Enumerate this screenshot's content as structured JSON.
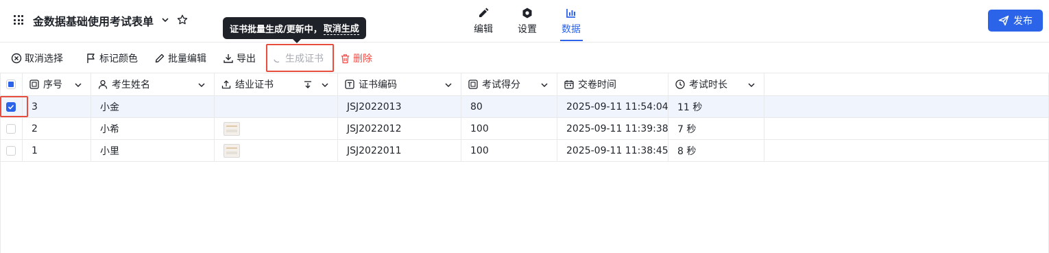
{
  "header": {
    "title": "金数据基础使用考试表单",
    "tabs": [
      {
        "label": "编辑",
        "icon": "pencil-icon"
      },
      {
        "label": "设置",
        "icon": "hexagon-settings-icon"
      },
      {
        "label": "数据",
        "icon": "bar-chart-icon",
        "active": true
      }
    ],
    "publish_label": "发布"
  },
  "tooltip": {
    "text": "证书批量生成/更新中，",
    "action": "取消生成"
  },
  "toolbar": {
    "cancel_select": "取消选择",
    "mark_color": "标记颜色",
    "batch_edit": "批量编辑",
    "export": "导出",
    "generate_cert": "生成证书",
    "delete": "删除"
  },
  "table": {
    "columns": [
      {
        "label": "序号",
        "icon": "number-field-icon"
      },
      {
        "label": "考生姓名",
        "icon": "person-icon"
      },
      {
        "label": "结业证书",
        "icon": "upload-icon"
      },
      {
        "label": "证书编码",
        "icon": "text-field-icon"
      },
      {
        "label": "考试得分",
        "icon": "number-field-icon"
      },
      {
        "label": "交卷时间",
        "icon": "calendar-icon"
      },
      {
        "label": "考试时长",
        "icon": "clock-icon"
      }
    ],
    "rows": [
      {
        "seq": "3",
        "name": "小金",
        "cert": "",
        "code": "JSJ2022013",
        "score": "80",
        "time": "2025-09-11 11:54:04",
        "duration": "11 秒",
        "selected": true
      },
      {
        "seq": "2",
        "name": "小希",
        "cert": "thumbnail",
        "code": "JSJ2022012",
        "score": "100",
        "time": "2025-09-11 11:39:38",
        "duration": "7 秒",
        "selected": false
      },
      {
        "seq": "1",
        "name": "小里",
        "cert": "thumbnail",
        "code": "JSJ2022011",
        "score": "100",
        "time": "2025-09-11 11:38:45",
        "duration": "8 秒",
        "selected": false
      }
    ]
  },
  "colors": {
    "accent": "#2b64e8",
    "danger": "#f54a45",
    "highlight": "#e74c3c"
  }
}
